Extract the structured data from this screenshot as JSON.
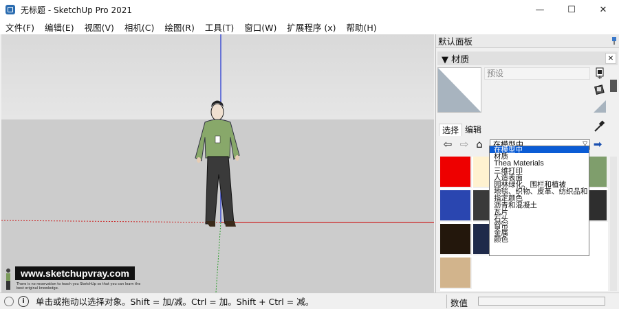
{
  "window": {
    "title": "无标题 - SketchUp Pro 2021",
    "minimize": "—",
    "maximize": "☐",
    "close": "✕"
  },
  "menu": [
    "文件(F)",
    "编辑(E)",
    "视图(V)",
    "相机(C)",
    "绘图(R)",
    "工具(T)",
    "窗口(W)",
    "扩展程序 (x)",
    "帮助(H)"
  ],
  "watermark": {
    "banner": "www.sketchupvray.com",
    "small": "There is no reservation to teach you SketchUp so that you can learn the best original knowledge."
  },
  "tray": {
    "title": "默认面板",
    "materials": {
      "header": "▼ 材质",
      "close": "✕",
      "name_placeholder": "预设",
      "tabs": [
        "选择",
        "编辑"
      ],
      "selected_library": "在模型中",
      "library_options": [
        "在模型中",
        "材质",
        "Thea Materials",
        "三维打印",
        "人造表面",
        "园林绿化、围栏和植被",
        "地毯、织物、皮革、纺织品和",
        "指定颜色",
        "沥青和混凝土",
        "瓦片",
        "石头",
        "窗帘",
        "金属",
        "颜色"
      ],
      "swatch_colors": [
        "#ee0000",
        "#fff2d0",
        "#7f9e6c",
        "#2a46b0",
        "#3a3a3a",
        "#2e2e2e",
        "#23170c",
        "#1f2a4a",
        "#d2b48c"
      ]
    }
  },
  "status": {
    "info_icon": "i",
    "hint": "单击或拖动以选择对象。Shift = 加/减。Ctrl = 加。Shift + Ctrl = 减。",
    "measurements_label": "数值"
  },
  "colors": {
    "axis_blue": "#1b2fd1",
    "axis_red": "#cc2222",
    "axis_green": "#2e9e2e",
    "selection": "#0b5cd5"
  }
}
